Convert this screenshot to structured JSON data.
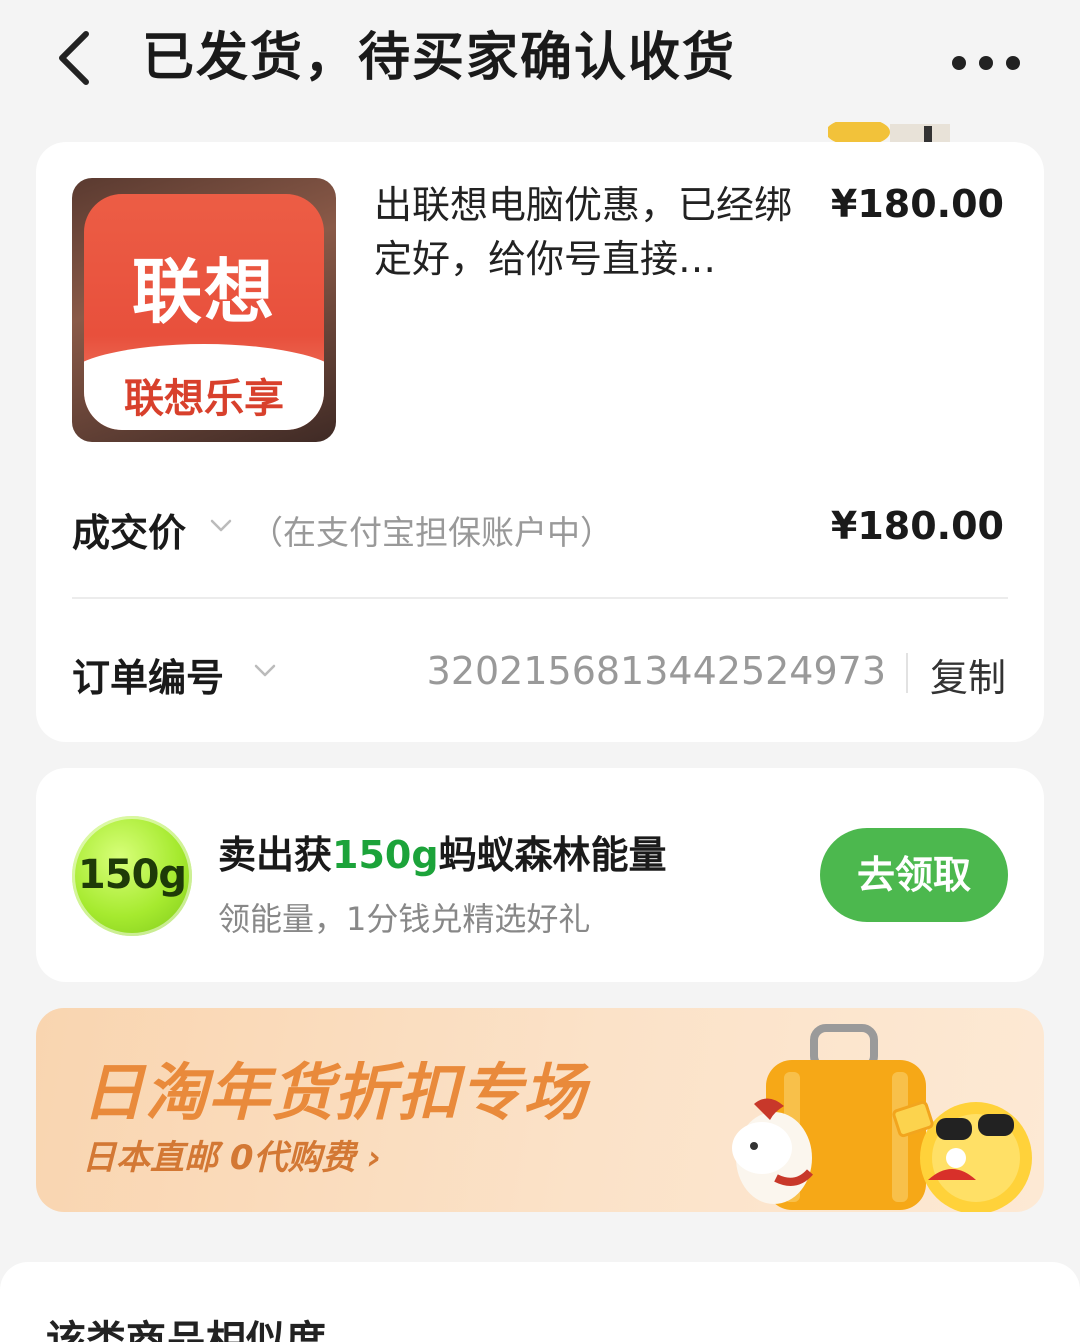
{
  "header": {
    "title": "已发货，待买家确认收货"
  },
  "item": {
    "thumbnail_big_text": "联想",
    "thumbnail_small_text": "联想乐享",
    "title": "出联想电脑优惠，已经绑定好，给你号直接…",
    "price": "¥180.00"
  },
  "deal": {
    "label": "成交价",
    "note": "（在支付宝担保账户中）",
    "value": "¥180.00"
  },
  "order": {
    "label": "订单编号",
    "number": "3202156813442524973",
    "copy_label": "复制"
  },
  "energy": {
    "badge": "150g",
    "title_prefix": "卖出获",
    "title_highlight": "150g",
    "title_suffix": "蚂蚁森林能量",
    "subtitle": "领能量，1分钱兑精选好礼",
    "button_label": "去领取",
    "accent_color": "#1ca33a",
    "button_color": "#4cb84e"
  },
  "banner": {
    "title": "日淘年货折扣专场",
    "subtitle": "日本直邮 0代购费",
    "title_color": "#e98a3b"
  },
  "bottom": {
    "text": "该类商品相似度"
  }
}
